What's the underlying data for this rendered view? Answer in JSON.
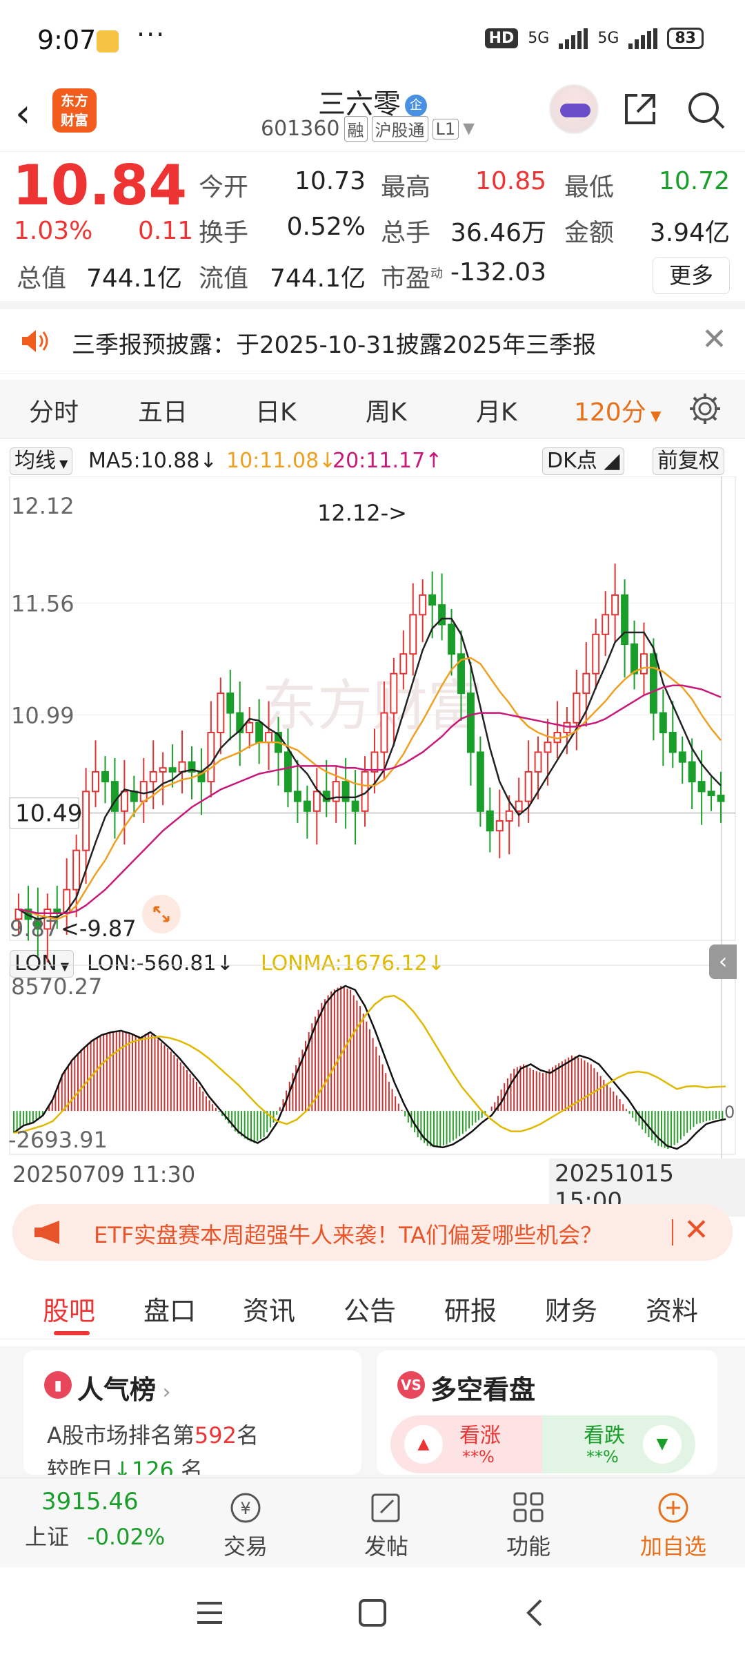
{
  "status": {
    "time": "9:07",
    "dots": "···",
    "hd": "HD",
    "net1": "5G",
    "net2": "5G",
    "battery": "83"
  },
  "nav": {
    "logo_line1": "东方",
    "logo_line2": "财富",
    "stock_name": "三六零",
    "badge": "企",
    "stock_code": "601360",
    "tags": [
      "融",
      "沪股通",
      "L1"
    ]
  },
  "quote": {
    "price": "10.84",
    "change_pct": "1.03%",
    "change_amt": "0.11",
    "items": [
      {
        "label": "今开",
        "value": "10.73"
      },
      {
        "label": "最高",
        "value": "10.85"
      },
      {
        "label": "最低",
        "value": "10.72"
      },
      {
        "label": "换手",
        "value": "0.52%"
      },
      {
        "label": "总手",
        "value": "36.46万"
      },
      {
        "label": "金额",
        "value": "3.94亿"
      },
      {
        "label": "总值",
        "value": "744.1亿"
      },
      {
        "label": "流值",
        "value": "744.1亿"
      },
      {
        "label": "市盈",
        "value": "-132.03"
      }
    ],
    "pe_sup": "动",
    "more": "更多"
  },
  "notice": {
    "text": "三季报预披露：于2025-10-31披露2025年三季报"
  },
  "tabs": [
    "分时",
    "五日",
    "日K",
    "周K",
    "月K",
    "120分"
  ],
  "chart_toolbar": {
    "indicator": "均线",
    "ma5": "MA5:10.88",
    "ma10": "10:11.08",
    "ma20": "20:11.17",
    "dk": "DK点",
    "adjust": "前复权"
  },
  "lon_toolbar": {
    "indicator": "LON",
    "lon": "LON:-560.81",
    "lonma": "LONMA:1676.12"
  },
  "chart_labels": {
    "high_mark": "12.12->",
    "low_mark": "<-9.87",
    "low_tick": "9.87",
    "current": "10.49",
    "lon_top": "8570.27",
    "lon_bottom": "-2693.91",
    "lon_zero": "0",
    "date_start": "20250709 11:30",
    "date_end": "20251015 15:00",
    "watermark": "东方财富"
  },
  "chart_data": [
    {
      "type": "candlestick",
      "title": "",
      "y_ticks": [
        "12.12",
        "11.56",
        "10.99"
      ],
      "ylim": [
        9.87,
        12.12
      ],
      "x_range": [
        "20250709 11:30",
        "20251015 15:00"
      ],
      "grid": true,
      "close": [
        10.0,
        9.95,
        9.9,
        10.0,
        9.98,
        10.1,
        10.3,
        10.6,
        10.7,
        10.65,
        10.5,
        10.6,
        10.55,
        10.65,
        10.7,
        10.72,
        10.7,
        10.75,
        10.7,
        10.65,
        10.9,
        11.1,
        11.0,
        10.9,
        10.95,
        10.85,
        10.9,
        10.8,
        10.6,
        10.55,
        10.5,
        10.6,
        10.55,
        10.65,
        10.55,
        10.5,
        10.7,
        10.8,
        11.0,
        11.2,
        11.3,
        11.5,
        11.6,
        11.55,
        11.45,
        11.3,
        11.1,
        10.8,
        10.5,
        10.4,
        10.45,
        10.5,
        10.55,
        10.7,
        10.8,
        10.85,
        10.9,
        10.95,
        11.1,
        11.2,
        11.4,
        11.5,
        11.6,
        11.35,
        11.2,
        11.3,
        11.0,
        10.9,
        10.8,
        10.75,
        10.65,
        10.6,
        10.58,
        10.55
      ],
      "series": [
        {
          "name": "MA5",
          "values": [
            10.0,
            9.97,
            9.95,
            9.96,
            9.96,
            9.99,
            10.06,
            10.2,
            10.34,
            10.47,
            10.55,
            10.61,
            10.6,
            10.59,
            10.6,
            10.64,
            10.66,
            10.7,
            10.71,
            10.7,
            10.74,
            10.82,
            10.87,
            10.91,
            10.97,
            10.96,
            10.92,
            10.89,
            10.82,
            10.74,
            10.69,
            10.61,
            10.56,
            10.57,
            10.57,
            10.57,
            10.59,
            10.64,
            10.71,
            10.84,
            11.0,
            11.16,
            11.32,
            11.43,
            11.48,
            11.48,
            11.4,
            11.24,
            11.03,
            10.82,
            10.65,
            10.55,
            10.48,
            10.52,
            10.6,
            10.68,
            10.76,
            10.84,
            10.92,
            11.01,
            11.13,
            11.24,
            11.36,
            11.41,
            11.41,
            11.41,
            11.33,
            11.15,
            11.04,
            10.93,
            10.82,
            10.74,
            10.68,
            10.63
          ]
        },
        {
          "name": "MA10",
          "values": [
            10.0,
            9.99,
            9.97,
            9.96,
            9.95,
            9.97,
            10.02,
            10.1,
            10.18,
            10.25,
            10.34,
            10.42,
            10.49,
            10.55,
            10.58,
            10.62,
            10.64,
            10.66,
            10.67,
            10.69,
            10.72,
            10.76,
            10.78,
            10.8,
            10.83,
            10.85,
            10.85,
            10.85,
            10.83,
            10.81,
            10.77,
            10.73,
            10.7,
            10.68,
            10.66,
            10.64,
            10.63,
            10.63,
            10.66,
            10.72,
            10.79,
            10.88,
            10.96,
            11.05,
            11.14,
            11.22,
            11.27,
            11.28,
            11.25,
            11.18,
            11.11,
            11.05,
            10.98,
            10.93,
            10.9,
            10.88,
            10.87,
            10.88,
            10.91,
            10.96,
            11.01,
            11.06,
            11.12,
            11.17,
            11.21,
            11.23,
            11.23,
            11.21,
            11.17,
            11.13,
            11.07,
            10.99,
            10.92,
            10.86
          ]
        },
        {
          "name": "MA20",
          "values": [
            10.0,
            9.99,
            9.98,
            9.98,
            9.98,
            9.98,
            9.99,
            10.02,
            10.06,
            10.1,
            10.15,
            10.2,
            10.25,
            10.3,
            10.35,
            10.4,
            10.44,
            10.48,
            10.52,
            10.55,
            10.58,
            10.61,
            10.63,
            10.65,
            10.67,
            10.69,
            10.7,
            10.71,
            10.72,
            10.73,
            10.73,
            10.73,
            10.73,
            10.73,
            10.72,
            10.72,
            10.71,
            10.71,
            10.71,
            10.72,
            10.74,
            10.77,
            10.8,
            10.84,
            10.88,
            10.93,
            10.97,
            10.99,
            11.0,
            11.0,
            11.0,
            10.99,
            10.98,
            10.97,
            10.96,
            10.95,
            10.94,
            10.93,
            10.93,
            10.94,
            10.95,
            10.97,
            11.0,
            11.03,
            11.06,
            11.09,
            11.11,
            11.13,
            11.14,
            11.14,
            11.13,
            11.12,
            11.1,
            11.08
          ]
        }
      ]
    },
    {
      "type": "bar",
      "title": "",
      "y_ticks": [
        "8570.27",
        "-2693.91"
      ],
      "ylim": [
        -2693.91,
        8570.27
      ],
      "series": [
        {
          "name": "LON",
          "values": [
            -1500,
            -1000,
            -800,
            -300,
            800,
            2500,
            3500,
            4200,
            4800,
            5200,
            5400,
            5500,
            5300,
            5000,
            5400,
            4900,
            4300,
            3600,
            2800,
            2000,
            1000,
            200,
            -600,
            -1400,
            -1900,
            -2200,
            -1800,
            -800,
            800,
            2600,
            4200,
            6000,
            7400,
            8200,
            8570,
            8300,
            7200,
            5600,
            3800,
            2000,
            500,
            -800,
            -1800,
            -2400,
            -2500,
            -2300,
            -1900,
            -1400,
            -800,
            -300,
            600,
            1900,
            2900,
            3200,
            2800,
            2600,
            3000,
            3400,
            3800,
            3600,
            3200,
            2400,
            1600,
            800,
            -200,
            -1000,
            -1800,
            -2400,
            -2600,
            -2200,
            -1500,
            -900,
            -700,
            -560.81
          ]
        },
        {
          "name": "LONMA",
          "values": [
            -1500,
            -1400,
            -1200,
            -1000,
            -700,
            0,
            800,
            1600,
            2400,
            3200,
            3800,
            4300,
            4700,
            4900,
            5000,
            5100,
            5000,
            4800,
            4500,
            4100,
            3600,
            3000,
            2400,
            1800,
            1100,
            400,
            -200,
            -700,
            -900,
            -600,
            0,
            900,
            2000,
            3200,
            4400,
            5500,
            6500,
            7300,
            7800,
            7900,
            7500,
            6800,
            5900,
            4800,
            3700,
            2600,
            1600,
            800,
            0,
            -600,
            -1100,
            -1400,
            -1400,
            -1200,
            -900,
            -500,
            -100,
            300,
            700,
            1100,
            1500,
            1900,
            2300,
            2600,
            2700,
            2600,
            2300,
            1900,
            1500,
            1676.12,
            1700,
            1600,
            1650,
            1676.12
          ]
        }
      ]
    }
  ],
  "banner": {
    "text": "ETF实盘赛本周超强牛人来袭！TA们偏爱哪些机会？"
  },
  "subtabs": [
    "股吧",
    "盘口",
    "资讯",
    "公告",
    "研报",
    "财务",
    "资料"
  ],
  "cards": {
    "popularity": {
      "title": "人气榜",
      "line1_pre": "A股市场排名第",
      "line1_num": "592",
      "line1_post": "名",
      "line2_pre": "较昨日",
      "line2_num": "126",
      "line2_post": "名"
    },
    "bullbear": {
      "title": "多空看盘",
      "bull": "看涨",
      "bear": "看跌",
      "bull_val": "**%",
      "bear_val": "**%"
    }
  },
  "bottom": {
    "index_value": "3915.46",
    "index_name": "上证",
    "index_change": "-0.02%",
    "items": [
      "交易",
      "发帖",
      "功能",
      "加自选"
    ]
  },
  "colors": {
    "red": "#e33333",
    "green": "#1a9e2a",
    "accent": "#e8701a",
    "ma5": "#222222",
    "ma10": "#f0a020",
    "ma20": "#c8187a",
    "lonma": "#e0b800"
  }
}
